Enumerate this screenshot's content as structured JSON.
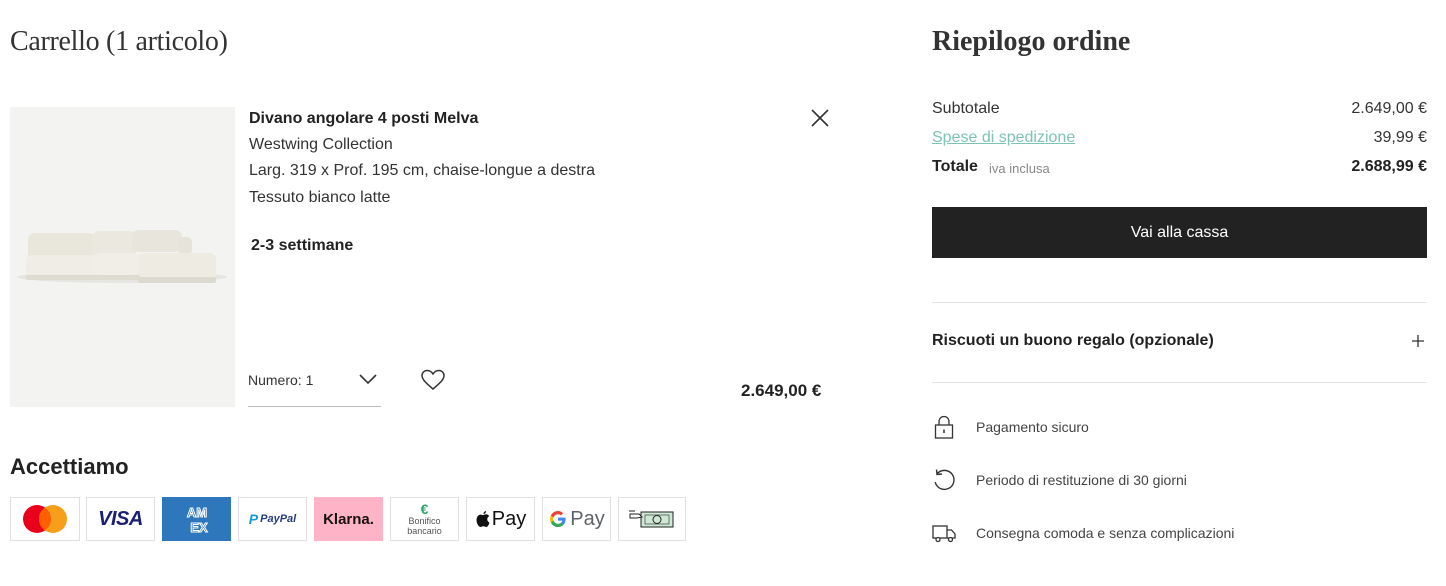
{
  "cart": {
    "title": "Carrello (1 articolo)",
    "item": {
      "name": "Divano angolare 4 posti Melva",
      "brand": "Westwing Collection",
      "size": "Larg. 319 x Prof. 195 cm, chaise-longue a destra",
      "fabric": "Tessuto bianco latte",
      "delivery": "2-3 settimane",
      "quantity_label": "Numero: 1",
      "price": "2.649,00 €"
    },
    "payments": {
      "title": "Accettiamo",
      "methods": [
        {
          "name": "Mastercard",
          "icon": "mastercard-icon"
        },
        {
          "name": "VISA",
          "icon": "visa-icon",
          "color": "#1a1f71"
        },
        {
          "name": "AMEX",
          "icon": "amex-icon",
          "color": "#2e77bc"
        },
        {
          "name": "PayPal",
          "icon": "paypal-icon",
          "color": "#253b80"
        },
        {
          "name": "Klarna.",
          "icon": "klarna-icon",
          "color": "#ffb3c7"
        },
        {
          "name": "Bonifico bancario",
          "line1": "Bonifico",
          "line2": "bancario",
          "icon": "bank-transfer-icon",
          "symbol": "€"
        },
        {
          "name": "Pay",
          "icon": "apple-pay-icon"
        },
        {
          "name": "Pay",
          "icon": "google-pay-icon"
        },
        {
          "name": "Cash",
          "icon": "cash-icon"
        }
      ]
    }
  },
  "summary": {
    "title": "Riepilogo ordine",
    "subtotal_label": "Subtotale",
    "subtotal_value": "2.649,00 €",
    "shipping_label": "Spese di spedizione",
    "shipping_value": "39,99 €",
    "total_label": "Totale",
    "total_note": "iva inclusa",
    "total_value": "2.688,99 €",
    "checkout_label": "Vai alla cassa",
    "voucher_label": "Riscuoti un buono regalo (opzionale)",
    "benefits": [
      {
        "text": "Pagamento sicuro",
        "icon": "lock-icon"
      },
      {
        "text": "Periodo di restituzione di 30 giorni",
        "icon": "return-icon"
      },
      {
        "text": "Consegna comoda e senza complicazioni",
        "icon": "truck-icon"
      }
    ]
  },
  "colors": {
    "accent_link": "#7ec3b5",
    "checkout_bg": "#222222",
    "klarna_pink": "#ffb3c7"
  }
}
